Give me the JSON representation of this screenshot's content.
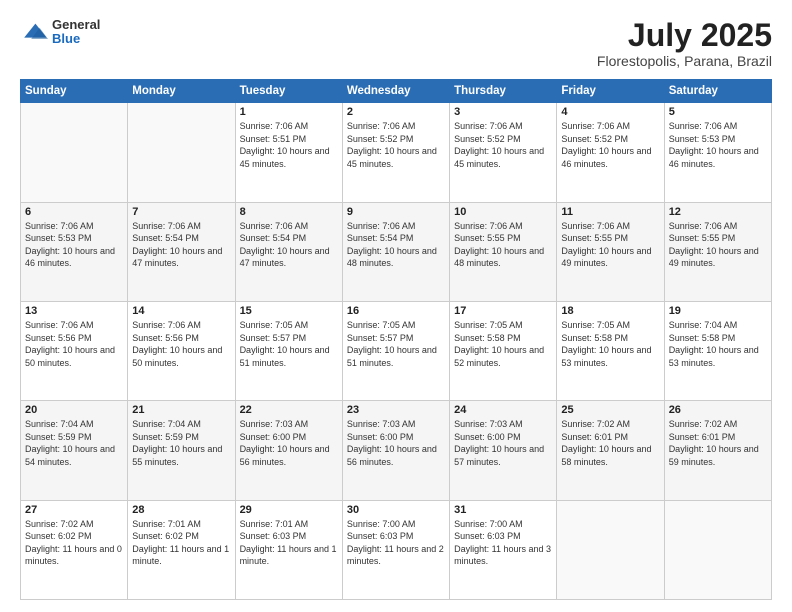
{
  "header": {
    "logo": {
      "general": "General",
      "blue": "Blue"
    },
    "title": "July 2025",
    "location": "Florestopolis, Parana, Brazil"
  },
  "calendar": {
    "days_of_week": [
      "Sunday",
      "Monday",
      "Tuesday",
      "Wednesday",
      "Thursday",
      "Friday",
      "Saturday"
    ],
    "weeks": [
      [
        {
          "day": "",
          "info": ""
        },
        {
          "day": "",
          "info": ""
        },
        {
          "day": "1",
          "info": "Sunrise: 7:06 AM\nSunset: 5:51 PM\nDaylight: 10 hours and 45 minutes."
        },
        {
          "day": "2",
          "info": "Sunrise: 7:06 AM\nSunset: 5:52 PM\nDaylight: 10 hours and 45 minutes."
        },
        {
          "day": "3",
          "info": "Sunrise: 7:06 AM\nSunset: 5:52 PM\nDaylight: 10 hours and 45 minutes."
        },
        {
          "day": "4",
          "info": "Sunrise: 7:06 AM\nSunset: 5:52 PM\nDaylight: 10 hours and 46 minutes."
        },
        {
          "day": "5",
          "info": "Sunrise: 7:06 AM\nSunset: 5:53 PM\nDaylight: 10 hours and 46 minutes."
        }
      ],
      [
        {
          "day": "6",
          "info": "Sunrise: 7:06 AM\nSunset: 5:53 PM\nDaylight: 10 hours and 46 minutes."
        },
        {
          "day": "7",
          "info": "Sunrise: 7:06 AM\nSunset: 5:54 PM\nDaylight: 10 hours and 47 minutes."
        },
        {
          "day": "8",
          "info": "Sunrise: 7:06 AM\nSunset: 5:54 PM\nDaylight: 10 hours and 47 minutes."
        },
        {
          "day": "9",
          "info": "Sunrise: 7:06 AM\nSunset: 5:54 PM\nDaylight: 10 hours and 48 minutes."
        },
        {
          "day": "10",
          "info": "Sunrise: 7:06 AM\nSunset: 5:55 PM\nDaylight: 10 hours and 48 minutes."
        },
        {
          "day": "11",
          "info": "Sunrise: 7:06 AM\nSunset: 5:55 PM\nDaylight: 10 hours and 49 minutes."
        },
        {
          "day": "12",
          "info": "Sunrise: 7:06 AM\nSunset: 5:55 PM\nDaylight: 10 hours and 49 minutes."
        }
      ],
      [
        {
          "day": "13",
          "info": "Sunrise: 7:06 AM\nSunset: 5:56 PM\nDaylight: 10 hours and 50 minutes."
        },
        {
          "day": "14",
          "info": "Sunrise: 7:06 AM\nSunset: 5:56 PM\nDaylight: 10 hours and 50 minutes."
        },
        {
          "day": "15",
          "info": "Sunrise: 7:05 AM\nSunset: 5:57 PM\nDaylight: 10 hours and 51 minutes."
        },
        {
          "day": "16",
          "info": "Sunrise: 7:05 AM\nSunset: 5:57 PM\nDaylight: 10 hours and 51 minutes."
        },
        {
          "day": "17",
          "info": "Sunrise: 7:05 AM\nSunset: 5:58 PM\nDaylight: 10 hours and 52 minutes."
        },
        {
          "day": "18",
          "info": "Sunrise: 7:05 AM\nSunset: 5:58 PM\nDaylight: 10 hours and 53 minutes."
        },
        {
          "day": "19",
          "info": "Sunrise: 7:04 AM\nSunset: 5:58 PM\nDaylight: 10 hours and 53 minutes."
        }
      ],
      [
        {
          "day": "20",
          "info": "Sunrise: 7:04 AM\nSunset: 5:59 PM\nDaylight: 10 hours and 54 minutes."
        },
        {
          "day": "21",
          "info": "Sunrise: 7:04 AM\nSunset: 5:59 PM\nDaylight: 10 hours and 55 minutes."
        },
        {
          "day": "22",
          "info": "Sunrise: 7:03 AM\nSunset: 6:00 PM\nDaylight: 10 hours and 56 minutes."
        },
        {
          "day": "23",
          "info": "Sunrise: 7:03 AM\nSunset: 6:00 PM\nDaylight: 10 hours and 56 minutes."
        },
        {
          "day": "24",
          "info": "Sunrise: 7:03 AM\nSunset: 6:00 PM\nDaylight: 10 hours and 57 minutes."
        },
        {
          "day": "25",
          "info": "Sunrise: 7:02 AM\nSunset: 6:01 PM\nDaylight: 10 hours and 58 minutes."
        },
        {
          "day": "26",
          "info": "Sunrise: 7:02 AM\nSunset: 6:01 PM\nDaylight: 10 hours and 59 minutes."
        }
      ],
      [
        {
          "day": "27",
          "info": "Sunrise: 7:02 AM\nSunset: 6:02 PM\nDaylight: 11 hours and 0 minutes."
        },
        {
          "day": "28",
          "info": "Sunrise: 7:01 AM\nSunset: 6:02 PM\nDaylight: 11 hours and 1 minute."
        },
        {
          "day": "29",
          "info": "Sunrise: 7:01 AM\nSunset: 6:03 PM\nDaylight: 11 hours and 1 minute."
        },
        {
          "day": "30",
          "info": "Sunrise: 7:00 AM\nSunset: 6:03 PM\nDaylight: 11 hours and 2 minutes."
        },
        {
          "day": "31",
          "info": "Sunrise: 7:00 AM\nSunset: 6:03 PM\nDaylight: 11 hours and 3 minutes."
        },
        {
          "day": "",
          "info": ""
        },
        {
          "day": "",
          "info": ""
        }
      ]
    ]
  }
}
